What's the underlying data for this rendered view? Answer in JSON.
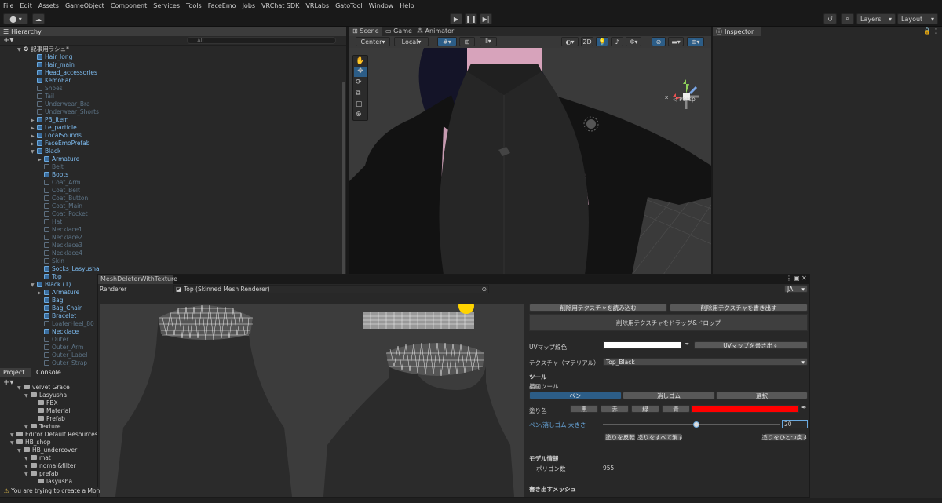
{
  "menu": [
    "File",
    "Edit",
    "Assets",
    "GameObject",
    "Component",
    "Services",
    "Tools",
    "FaceEmo",
    "Jobs",
    "VRChat SDK",
    "VRLabs",
    "GatoTool",
    "Window",
    "Help"
  ],
  "toolbar": {
    "account": "⬤ ▾",
    "layers": "Layers",
    "layout": "Layout"
  },
  "hierarchy": {
    "tab": "Hierarchy",
    "search_placeholder": "All",
    "scene_name": "記事用ラシュ*",
    "rows": [
      {
        "label": "Hair_long",
        "kind": "pref",
        "indent": 1
      },
      {
        "label": "Hair_main",
        "kind": "pref",
        "indent": 1
      },
      {
        "label": "Head_accessories",
        "kind": "pref",
        "indent": 1
      },
      {
        "label": "KemoEar",
        "kind": "pref",
        "indent": 1
      },
      {
        "label": "Shoes",
        "kind": "dim",
        "indent": 1
      },
      {
        "label": "Tail",
        "kind": "dim",
        "indent": 1
      },
      {
        "label": "Underwear_Bra",
        "kind": "dim",
        "indent": 1
      },
      {
        "label": "Underwear_Shorts",
        "kind": "dim",
        "indent": 1
      },
      {
        "label": "PB_item",
        "kind": "pref",
        "indent": 1,
        "arrow": "▶"
      },
      {
        "label": "Le_particle",
        "kind": "pref",
        "indent": 1,
        "arrow": "▶"
      },
      {
        "label": "LocalSounds",
        "kind": "pref",
        "indent": 1,
        "arrow": "▶"
      },
      {
        "label": "FaceEmoPrefab",
        "kind": "pref",
        "indent": 1,
        "arrow": "▶"
      },
      {
        "label": "Black",
        "kind": "pref",
        "indent": 1,
        "arrow": "▼"
      },
      {
        "label": "Armature",
        "kind": "pref",
        "indent": 2,
        "arrow": "▶"
      },
      {
        "label": "Belt",
        "kind": "dim",
        "indent": 2
      },
      {
        "label": "Boots",
        "kind": "pref",
        "indent": 2
      },
      {
        "label": "Coat_Arm",
        "kind": "dim",
        "indent": 2
      },
      {
        "label": "Coat_Belt",
        "kind": "dim",
        "indent": 2
      },
      {
        "label": "Coat_Button",
        "kind": "dim",
        "indent": 2
      },
      {
        "label": "Coat_Main",
        "kind": "dim",
        "indent": 2
      },
      {
        "label": "Coat_Pocket",
        "kind": "dim",
        "indent": 2
      },
      {
        "label": "Hat",
        "kind": "dim",
        "indent": 2
      },
      {
        "label": "Necklace1",
        "kind": "dim",
        "indent": 2
      },
      {
        "label": "Necklace2",
        "kind": "dim",
        "indent": 2
      },
      {
        "label": "Necklace3",
        "kind": "dim",
        "indent": 2
      },
      {
        "label": "Necklace4",
        "kind": "dim",
        "indent": 2
      },
      {
        "label": "Skin",
        "kind": "dim",
        "indent": 2
      },
      {
        "label": "Socks_Lasyusha",
        "kind": "pref",
        "indent": 2
      },
      {
        "label": "Top",
        "kind": "pref",
        "indent": 2
      },
      {
        "label": "Black (1)",
        "kind": "pref",
        "indent": 1,
        "arrow": "▼"
      },
      {
        "label": "Armature",
        "kind": "pref",
        "indent": 2,
        "arrow": "▶"
      },
      {
        "label": "Bag",
        "kind": "pref",
        "indent": 2
      },
      {
        "label": "Bag_Chain",
        "kind": "pref",
        "indent": 2
      },
      {
        "label": "Bracelet",
        "kind": "pref",
        "indent": 2
      },
      {
        "label": "LoaferHeel_80",
        "kind": "dim",
        "indent": 2
      },
      {
        "label": "Necklace",
        "kind": "pref",
        "indent": 2
      },
      {
        "label": "Outer",
        "kind": "dim",
        "indent": 2
      },
      {
        "label": "Outer_Arm",
        "kind": "dim",
        "indent": 2
      },
      {
        "label": "Outer_Label",
        "kind": "dim",
        "indent": 2
      },
      {
        "label": "Outer_Strap",
        "kind": "dim",
        "indent": 2
      }
    ]
  },
  "project": {
    "tabs": [
      "Project",
      "Console"
    ],
    "rows": [
      {
        "label": "velvet Grace",
        "indent": 2
      },
      {
        "label": "Lasyusha",
        "indent": 3
      },
      {
        "label": "FBX",
        "indent": 4
      },
      {
        "label": "Material",
        "indent": 4
      },
      {
        "label": "Prefab",
        "indent": 4
      },
      {
        "label": "Texture",
        "indent": 3
      },
      {
        "label": "Editor Default Resources",
        "indent": 1
      },
      {
        "label": "HB_shop",
        "indent": 1
      },
      {
        "label": "HB_undercover",
        "indent": 2
      },
      {
        "label": "mat",
        "indent": 3
      },
      {
        "label": "nomal&filter",
        "indent": 3
      },
      {
        "label": "prefab",
        "indent": 3
      },
      {
        "label": "lasyusha",
        "indent": 4
      }
    ]
  },
  "scene": {
    "tabs": [
      "Scene",
      "Game",
      "Animator"
    ],
    "pivot": "Center",
    "space": "Local",
    "mode2d": "2D",
    "persp": "◁ Persp",
    "axis_x": "x"
  },
  "inspector": {
    "tab": "Inspector"
  },
  "tool": {
    "title": "MeshDeleterWithTexture",
    "renderer_label": "Renderer",
    "renderer_value": "Top (Skinned Mesh Renderer)",
    "lang": "JA",
    "load_texture": "削除用テクスチャを読み込む",
    "save_texture": "削除用テクスチャを書き出す",
    "drop_hint": "削除用テクスチャをドラッグ&ドロップ",
    "uv_color_label": "UVマップ線色",
    "uv_export": "UVマップを書き出す",
    "texture_label": "テクスチャ（マテリアル）",
    "texture_value": "Top_Black",
    "tools_heading": "ツール",
    "draw_tool_label": "描画ツール",
    "draw_tools": [
      "ペン",
      "消しゴム",
      "選択"
    ],
    "paint_color_label": "塗り色",
    "paint_colors": [
      "黒",
      "赤",
      "緑",
      "青"
    ],
    "pen_size_label": "ペン/消しゴム 大きさ",
    "pen_size_value": "20",
    "pen_size_fraction": 0.53,
    "invert_btn": "塗りを反転",
    "clear_btn": "塗りをすべて消す",
    "undo_btn": "塗りをひとつ戻す",
    "model_info": "モデル情報",
    "polygon_label": "ポリゴン数",
    "polygon_value": "955",
    "export_mesh": "書き出すメッシュ"
  },
  "status": {
    "message": "You are trying to create a Monol"
  },
  "colors": {
    "accent": "#2c5d87",
    "paint": "#ff0000",
    "uv_line": "#ffffff"
  }
}
